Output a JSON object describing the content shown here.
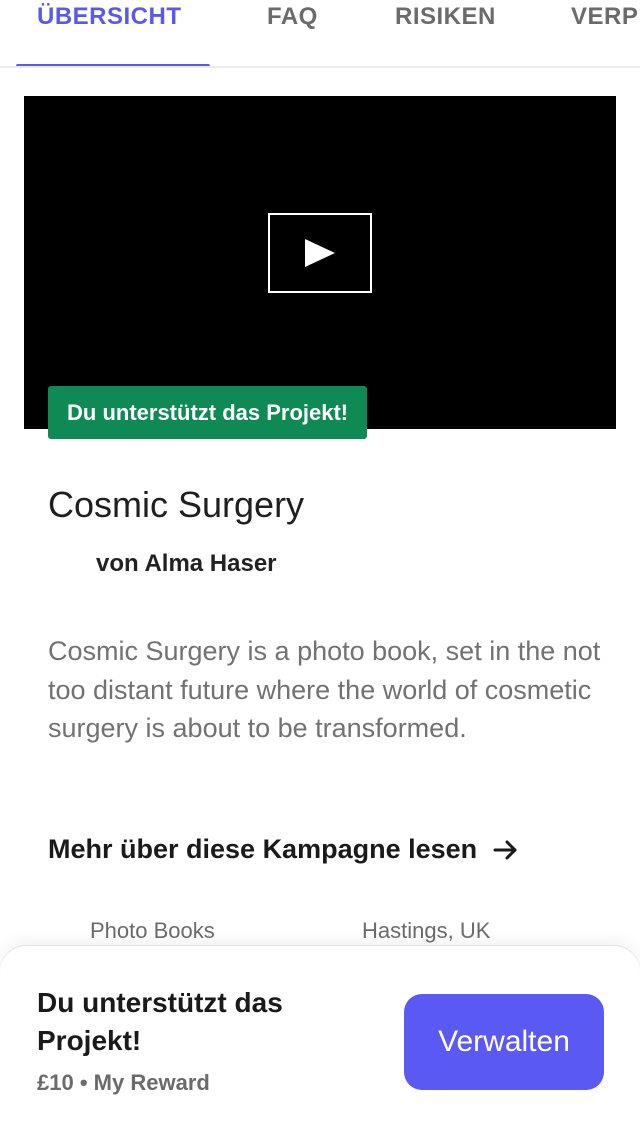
{
  "tabs": [
    {
      "label": "ÜBERSICHT",
      "active": true
    },
    {
      "label": "FAQ",
      "active": false
    },
    {
      "label": "RISIKEN",
      "active": false
    },
    {
      "label": "VERP",
      "active": false
    }
  ],
  "video": {
    "badge": "Du unterstützt das Projekt!",
    "play_icon": "play-icon"
  },
  "project": {
    "title": "Cosmic Surgery",
    "author": "von Alma Haser",
    "description": "Cosmic Surgery is a photo book, set in the not too distant future where the world of cosmetic surgery is about to be transformed.",
    "more_link": "Mehr über diese Kampagne lesen",
    "category": "Photo Books",
    "location": "Hastings, UK"
  },
  "bottom_bar": {
    "title": "Du unterstützt das Projekt!",
    "amount": "£10",
    "separator": "•",
    "reward": "My Reward",
    "manage_label": "Verwalten"
  },
  "colors": {
    "accent": "#5b59e8",
    "badge_green": "#0f8a55",
    "button": "#5b59f4"
  }
}
